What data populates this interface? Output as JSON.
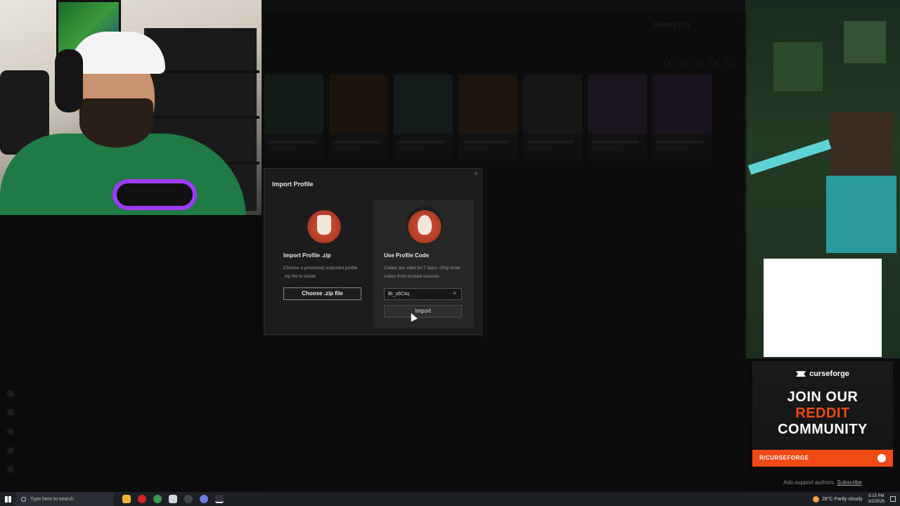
{
  "window": {
    "profile_label": "Modded (26)"
  },
  "modal": {
    "title": "Import Profile",
    "close_label": "×",
    "zip_option": {
      "title": "Import Profile .zip",
      "description": "Choose a previously exported profile .zip file to install",
      "button_label": "Choose .zip file"
    },
    "code_option": {
      "title": "Use Profile Code",
      "description": "Codes are valid for 7 days. Only enter codes from trusted sources",
      "code_value": "BI_s6Cliq",
      "clear_label": "×",
      "button_label": "Import"
    }
  },
  "ad": {
    "brand": "curseforge",
    "line1": "JOIN OUR",
    "line2": "REDDIT",
    "line3": "COMMUNITY",
    "cta": "R/CURSEFORGE",
    "support_text": "Ads support authors.",
    "support_link": "Subscribe"
  },
  "taskbar": {
    "search_placeholder": "Type here to search",
    "weather": "28°C  Partly cloudy",
    "time": "8:15 PM",
    "date": "3/2/2026"
  },
  "colors": {
    "accent": "#f04a17",
    "modal_bg": "#1c1c1c"
  }
}
